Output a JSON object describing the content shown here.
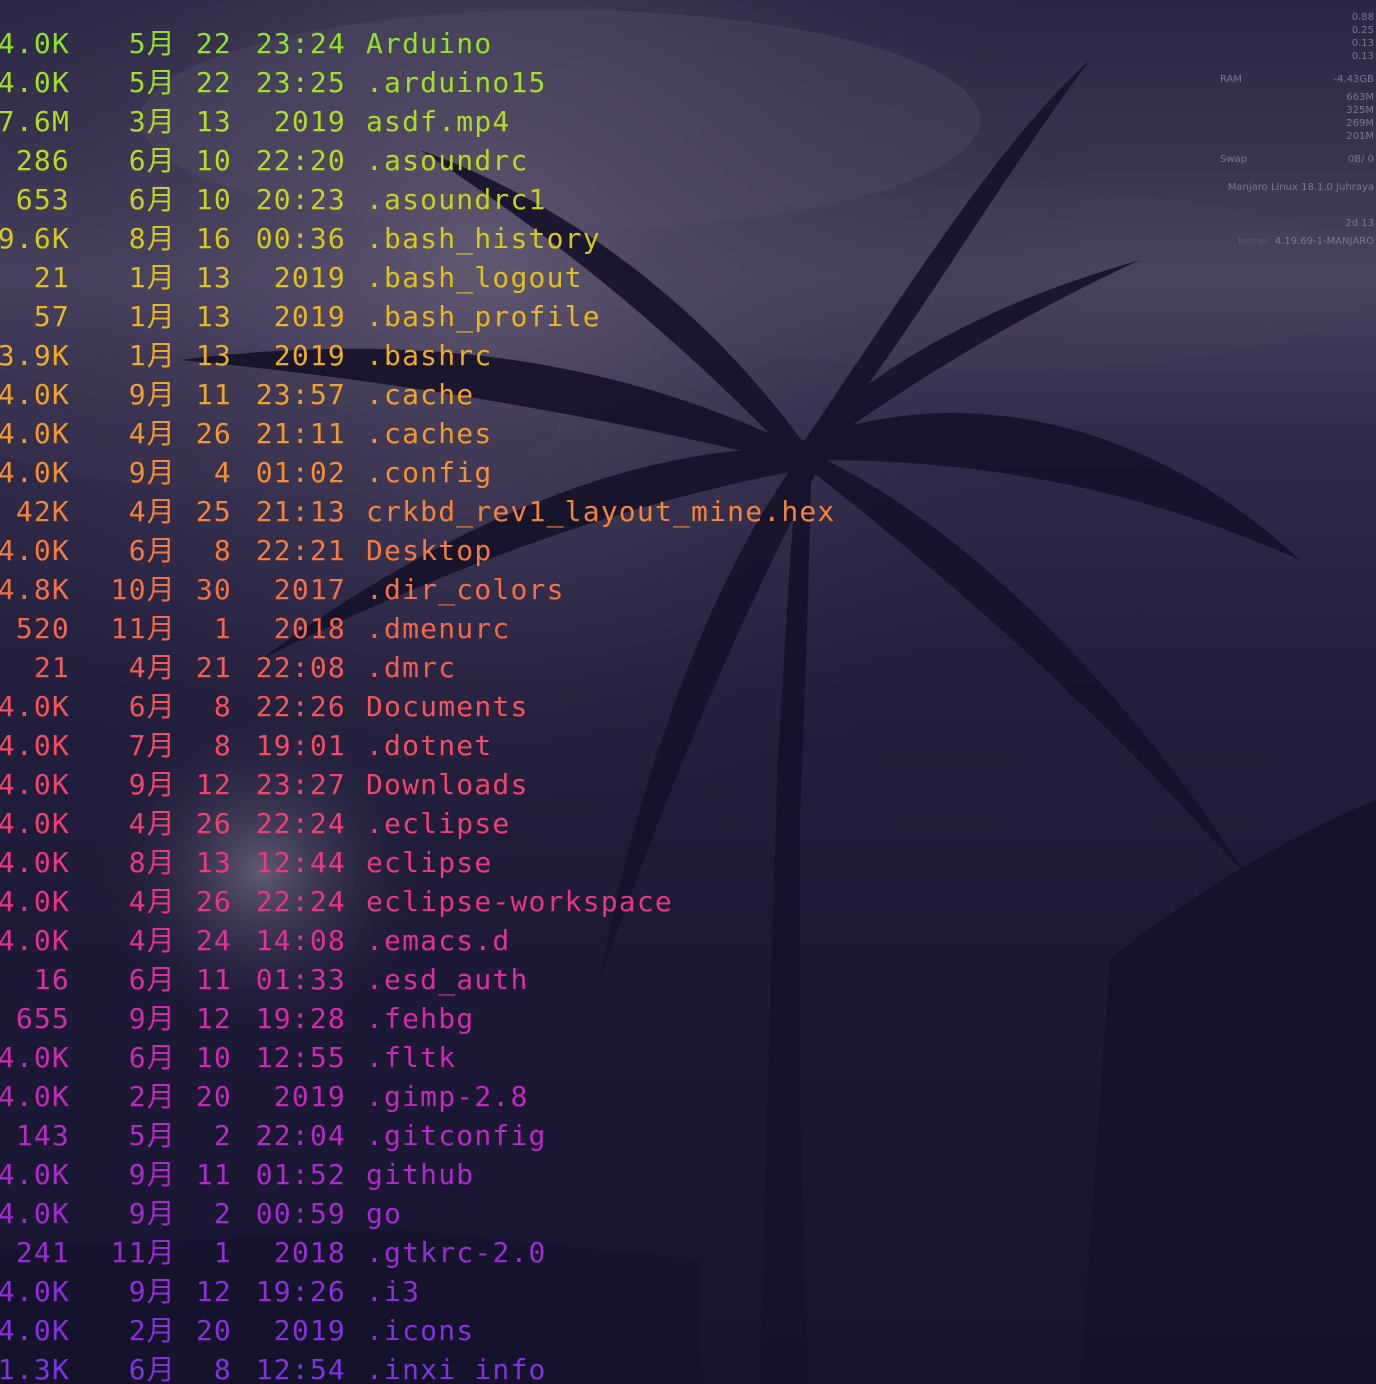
{
  "terminal": {
    "rows": [
      {
        "size": "4.0K",
        "month": "5月",
        "day": "22",
        "time": "23:24",
        "name": "Arduino",
        "color": "#8ee22c"
      },
      {
        "size": "4.0K",
        "month": "5月",
        "day": "22",
        "time": "23:25",
        "name": ".arduino15",
        "color": "#9ee02a"
      },
      {
        "size": "7.6M",
        "month": "3月",
        "day": "13",
        "time": " 2019",
        "name": "asdf.mp4",
        "color": "#aedc28"
      },
      {
        "size": "286",
        "month": "6月",
        "day": "10",
        "time": "22:20",
        "name": ".asoundrc",
        "color": "#bcd826"
      },
      {
        "size": "653",
        "month": "6月",
        "day": "10",
        "time": "20:23",
        "name": ".asoundrc1",
        "color": "#c8d024"
      },
      {
        "size": "9.6K",
        "month": "8月",
        "day": "16",
        "time": "00:36",
        "name": ".bash_history",
        "color": "#d4c822"
      },
      {
        "size": "21",
        "month": "1月",
        "day": "13",
        "time": " 2019",
        "name": ".bash_logout",
        "color": "#dec022"
      },
      {
        "size": "57",
        "month": "1月",
        "day": "13",
        "time": " 2019",
        "name": ".bash_profile",
        "color": "#e6b624"
      },
      {
        "size": "3.9K",
        "month": "1月",
        "day": "13",
        "time": " 2019",
        "name": ".bashrc",
        "color": "#ecac28"
      },
      {
        "size": "4.0K",
        "month": "9月",
        "day": "11",
        "time": "23:57",
        "name": ".cache",
        "color": "#f0a22c"
      },
      {
        "size": "4.0K",
        "month": "4月",
        "day": "26",
        "time": "21:11",
        "name": ".caches",
        "color": "#f29830"
      },
      {
        "size": "4.0K",
        "month": "9月",
        "day": " 4",
        "time": "01:02",
        "name": ".config",
        "color": "#f48e36"
      },
      {
        "size": "42K",
        "month": "4月",
        "day": "25",
        "time": "21:13",
        "name": "crkbd_rev1_layout_mine.hex",
        "color": "#f4843c"
      },
      {
        "size": "4.0K",
        "month": "6月",
        "day": " 8",
        "time": "22:21",
        "name": "Desktop",
        "color": "#f47a42"
      },
      {
        "size": "4.8K",
        "month": "10月",
        "day": "30",
        "time": " 2017",
        "name": ".dir_colors",
        "color": "#f47048"
      },
      {
        "size": "520",
        "month": "11月",
        "day": " 1",
        "time": " 2018",
        "name": ".dmenurc",
        "color": "#f4664e"
      },
      {
        "size": "21",
        "month": "4月",
        "day": "21",
        "time": "22:08",
        "name": ".dmrc",
        "color": "#f45c54"
      },
      {
        "size": "4.0K",
        "month": "6月",
        "day": " 8",
        "time": "22:26",
        "name": "Documents",
        "color": "#f4545c"
      },
      {
        "size": "4.0K",
        "month": "7月",
        "day": " 8",
        "time": "19:01",
        "name": ".dotnet",
        "color": "#f44c64"
      },
      {
        "size": "4.0K",
        "month": "9月",
        "day": "12",
        "time": "23:27",
        "name": "Downloads",
        "color": "#f2446c"
      },
      {
        "size": "4.0K",
        "month": "4月",
        "day": "26",
        "time": "22:24",
        "name": ".eclipse",
        "color": "#f03e76"
      },
      {
        "size": "4.0K",
        "month": "8月",
        "day": "13",
        "time": "12:44",
        "name": "eclipse",
        "color": "#ec3880"
      },
      {
        "size": "4.0K",
        "month": "4月",
        "day": "26",
        "time": "22:24",
        "name": "eclipse-workspace",
        "color": "#e8348a"
      },
      {
        "size": "4.0K",
        "month": "4月",
        "day": "24",
        "time": "14:08",
        "name": ".emacs.d",
        "color": "#e23094"
      },
      {
        "size": "16",
        "month": "6月",
        "day": "11",
        "time": "01:33",
        "name": ".esd_auth",
        "color": "#dc2e9e"
      },
      {
        "size": "655",
        "month": "9月",
        "day": "12",
        "time": "19:28",
        "name": ".fehbg",
        "color": "#d42ca8"
      },
      {
        "size": "4.0K",
        "month": "6月",
        "day": "10",
        "time": "12:55",
        "name": ".fltk",
        "color": "#cc2ab2"
      },
      {
        "size": "4.0K",
        "month": "2月",
        "day": "20",
        "time": " 2019",
        "name": ".gimp-2.8",
        "color": "#c22abc"
      },
      {
        "size": "143",
        "month": "5月",
        "day": " 2",
        "time": "22:04",
        "name": ".gitconfig",
        "color": "#b82ac4"
      },
      {
        "size": "4.0K",
        "month": "9月",
        "day": "11",
        "time": "01:52",
        "name": "github",
        "color": "#ae2acc"
      },
      {
        "size": "4.0K",
        "month": "9月",
        "day": " 2",
        "time": "00:59",
        "name": "go",
        "color": "#a42ad2"
      },
      {
        "size": "241",
        "month": "11月",
        "day": " 1",
        "time": " 2018",
        "name": ".gtkrc-2.0",
        "color": "#9a2cd8"
      },
      {
        "size": "4.0K",
        "month": "9月",
        "day": "12",
        "time": "19:26",
        "name": ".i3",
        "color": "#902edc"
      },
      {
        "size": "4.0K",
        "month": "2月",
        "day": "20",
        "time": " 2019",
        "name": ".icons",
        "color": "#8830e0"
      },
      {
        "size": "1.3K",
        "month": "6月",
        "day": " 8",
        "time": "12:54",
        "name": ".inxi_info",
        "color": "#8032e4"
      }
    ]
  },
  "conky": {
    "load": [
      "0.88",
      "0.25",
      "0.13",
      "0.13"
    ],
    "ram_label": "RAM",
    "ram_total": "-4.43GB",
    "ram_values": [
      "663M",
      "325M",
      "269M",
      "201M"
    ],
    "swap_label": "Swap",
    "swap_value": "0B/ 0",
    "distro": "Manjaro Linux 18.1.0 Juhraya",
    "uptime": "2d 13",
    "kernel_label": "kernel",
    "kernel": "4.19.69-1-MANJARO"
  }
}
